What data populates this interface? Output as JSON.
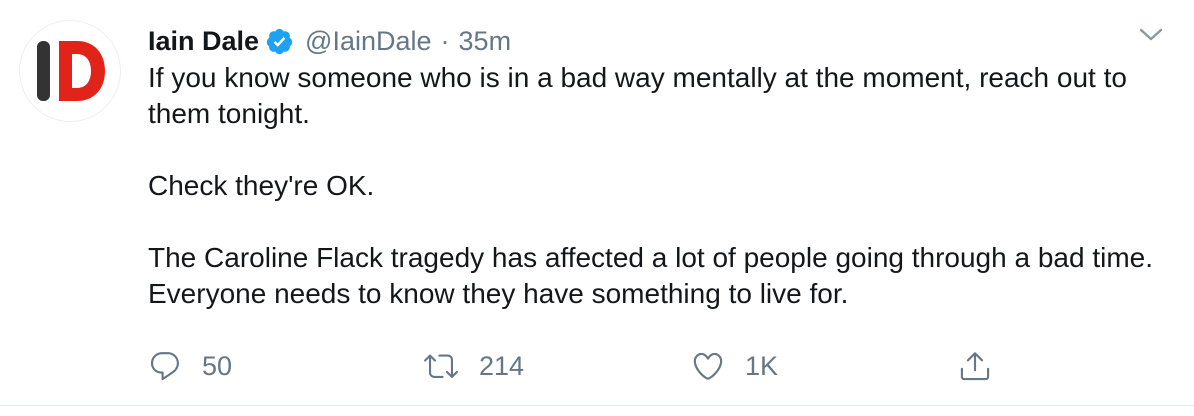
{
  "tweet": {
    "author": {
      "display_name": "Iain Dale",
      "handle": "@IainDale",
      "verified": true,
      "avatar_icon": "ID-logo",
      "avatar_text": "ID"
    },
    "separator": "·",
    "timestamp": "35m",
    "paragraphs": [
      "If you know someone who is in a bad way mentally at the moment, reach out to them tonight.",
      "Check they're OK.",
      "The Caroline Flack tragedy has affected a lot of people going through a bad time. Everyone needs to know they have something to live for."
    ],
    "actions": {
      "reply": {
        "icon": "reply-icon",
        "count": "50"
      },
      "retweet": {
        "icon": "retweet-icon",
        "count": "214"
      },
      "like": {
        "icon": "heart-icon",
        "count": "1K"
      },
      "share": {
        "icon": "share-icon"
      }
    },
    "menu_icon": "chevron-down-icon"
  },
  "colors": {
    "text_primary": "#14171a",
    "text_secondary": "#657786",
    "verified_blue": "#1da1f2",
    "logo_red": "#e2231a",
    "logo_dark": "#333333",
    "divider": "#e6ecf0"
  }
}
